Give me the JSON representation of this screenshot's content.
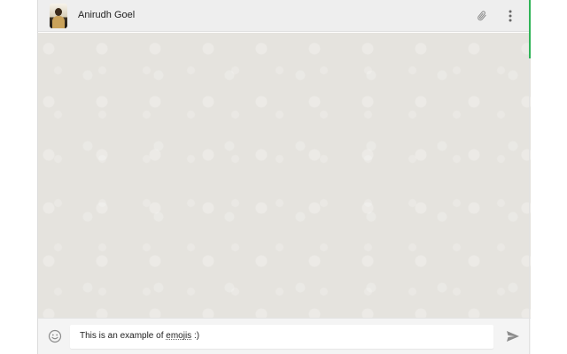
{
  "header": {
    "contact_name": "Anirudh Goel",
    "avatar_icon": "contact-photo",
    "attach_icon": "paperclip-icon",
    "menu_icon": "more-vert-icon"
  },
  "composer": {
    "text_before": "This is an example of ",
    "text_misspelled": "emojis",
    "text_after": " :)",
    "emoji_icon": "smiley-icon",
    "send_icon": "send-icon"
  },
  "colors": {
    "header_bg": "#eeeeee",
    "chat_bg": "#e5e3de",
    "accent_green": "#2fb357",
    "icon_gray": "#8c8c8c"
  }
}
